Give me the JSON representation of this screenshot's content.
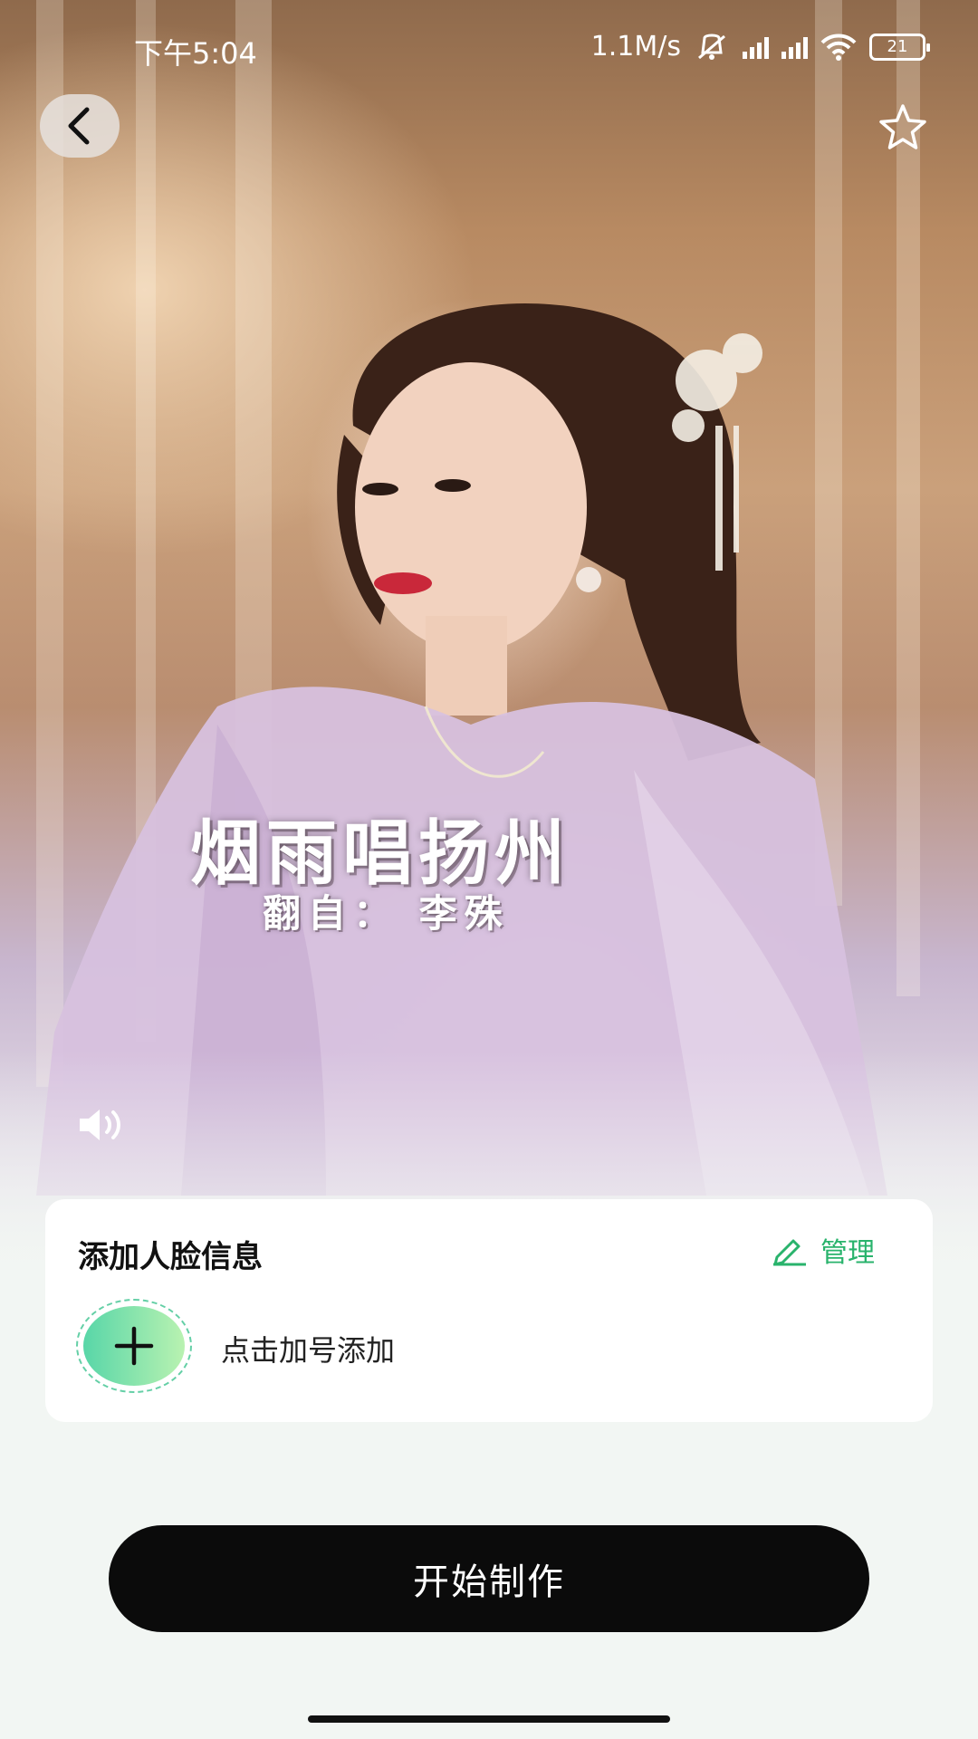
{
  "status_bar": {
    "time": "下午5:04",
    "speed": "1.1M/s",
    "battery": "21",
    "icons": [
      "mute-icon",
      "signal-hd-icon",
      "signal-hd-icon",
      "wifi-icon",
      "battery-icon"
    ]
  },
  "header": {
    "back_icon": "chevron-left-icon",
    "favorite_icon": "star-outline-icon"
  },
  "preview": {
    "song_title": "烟雨唱扬州",
    "subtitle": "翻自： 李殊",
    "volume_icon": "volume-icon"
  },
  "face_card": {
    "title": "添加人脸信息",
    "manage_label": "管理",
    "manage_icon": "pencil-icon",
    "add_icon": "plus-icon",
    "add_hint": "点击加号添加"
  },
  "actions": {
    "start_label": "开始制作"
  },
  "colors": {
    "accent_green": "#29b36c",
    "button_black": "#0b0b0b",
    "background": "#f2f6f3"
  }
}
